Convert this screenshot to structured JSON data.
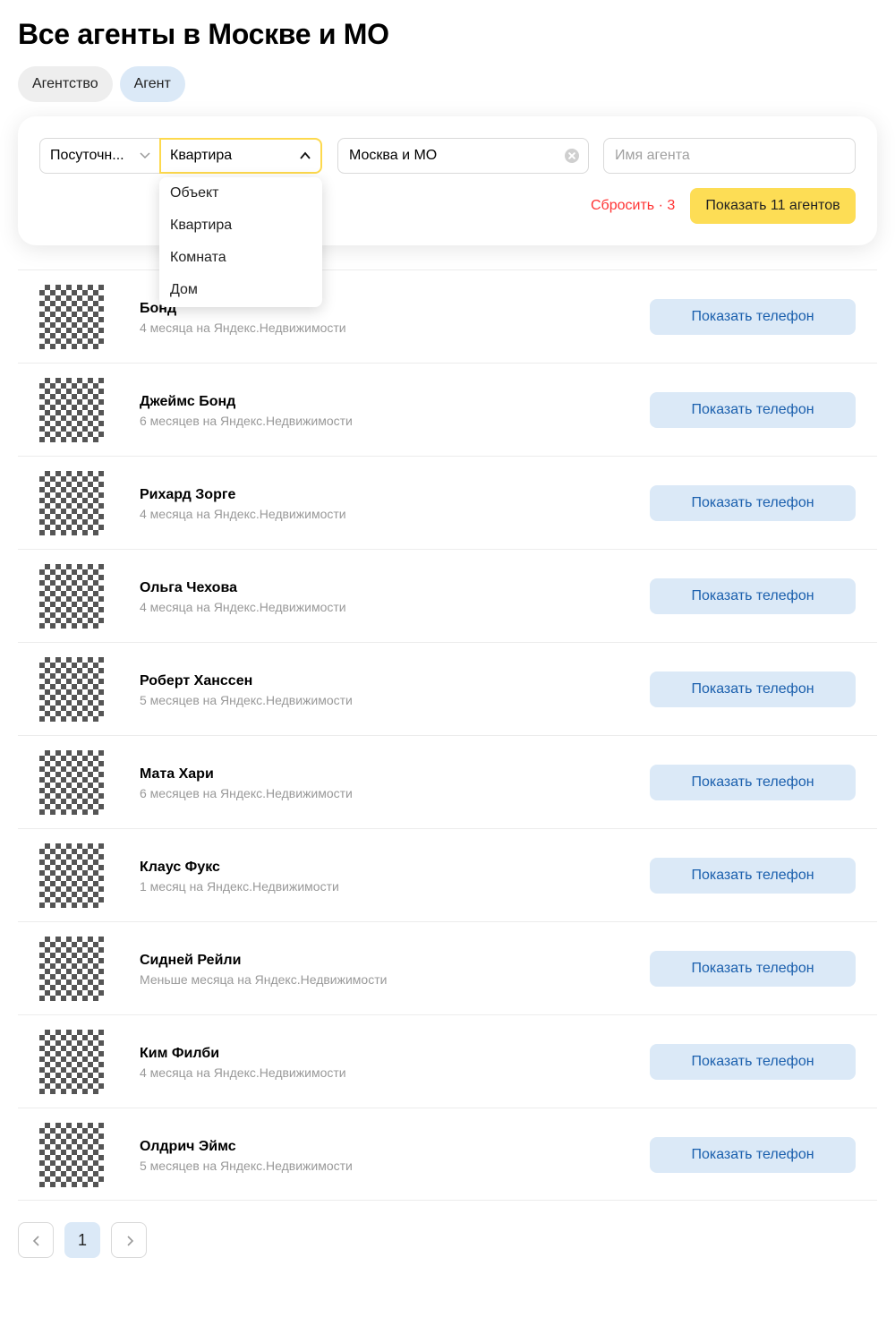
{
  "page_title": "Все агенты в Москве и МО",
  "type_tabs": [
    {
      "label": "Агентство",
      "active": false
    },
    {
      "label": "Агент",
      "active": true
    }
  ],
  "filters": {
    "deal_type": "Посуточн...",
    "object_type": "Квартира",
    "region": "Москва и МО",
    "agent_name_placeholder": "Имя агента",
    "reset_label": "Сбросить · 3",
    "show_label": "Показать 11 агентов",
    "object_options": [
      "Объект",
      "Квартира",
      "Комната",
      "Дом"
    ],
    "icons": {
      "select_arrow": "chevron-down-icon",
      "open_select_arrow": "chevron-up-icon",
      "clear": "clear-circle-icon"
    }
  },
  "agents": [
    {
      "name": "Бонд",
      "meta": "4 месяца на Яндекс.Недвижимости",
      "phone_label": "Показать телефон"
    },
    {
      "name": "Джеймс Бонд",
      "meta": "6 месяцев на Яндекс.Недвижимости",
      "phone_label": "Показать телефон"
    },
    {
      "name": "Рихард Зорге",
      "meta": "4 месяца на Яндекс.Недвижимости",
      "phone_label": "Показать телефон"
    },
    {
      "name": "Ольга Чехова",
      "meta": "4 месяца на Яндекс.Недвижимости",
      "phone_label": "Показать телефон"
    },
    {
      "name": "Роберт Ханссен",
      "meta": "5 месяцев на Яндекс.Недвижимости",
      "phone_label": "Показать телефон"
    },
    {
      "name": "Мата Хари",
      "meta": "6 месяцев на Яндекс.Недвижимости",
      "phone_label": "Показать телефон"
    },
    {
      "name": "Клаус Фукс",
      "meta": "1 месяц на Яндекс.Недвижимости",
      "phone_label": "Показать телефон"
    },
    {
      "name": "Сидней Рейли",
      "meta": "Меньше месяца на Яндекс.Недвижимости",
      "phone_label": "Показать телефон"
    },
    {
      "name": "Ким Филби",
      "meta": "4 месяца на Яндекс.Недвижимости",
      "phone_label": "Показать телефон"
    },
    {
      "name": "Олдрич Эймс",
      "meta": "5 месяцев на Яндекс.Недвижимости",
      "phone_label": "Показать телефон"
    }
  ],
  "pagination": {
    "current_page": "1",
    "icons": {
      "prev": "chevron-left-icon",
      "next": "chevron-right-icon"
    }
  },
  "colors": {
    "accent_yellow": "#fddd55",
    "focus_yellow": "#fdd94d",
    "reset_red": "#ff3333",
    "phone_button_bg": "#dbe9f7",
    "phone_button_text": "#1a5fad"
  }
}
